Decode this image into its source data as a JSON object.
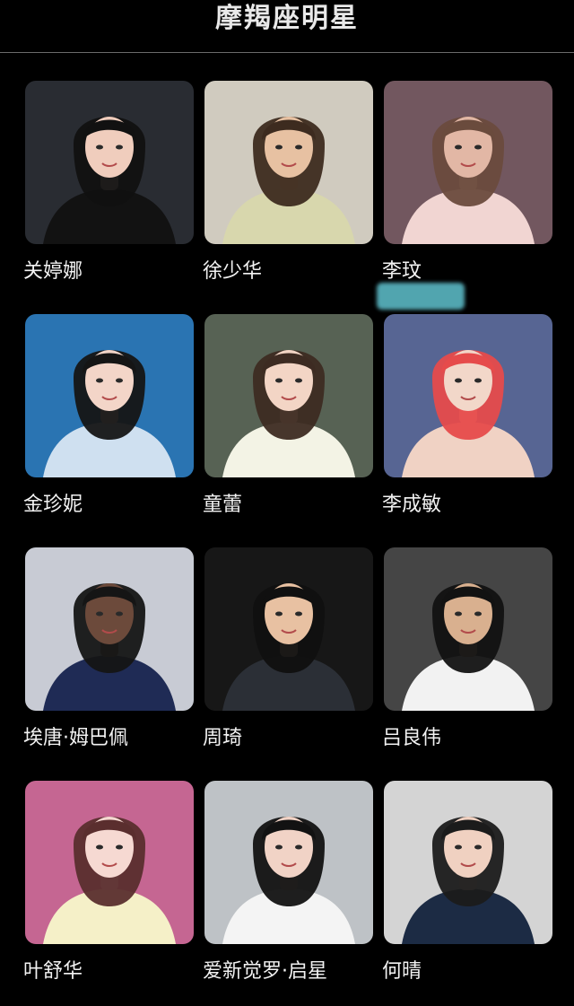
{
  "header": {
    "title": "摩羯座明星"
  },
  "celebrities": [
    {
      "name": "关婷娜",
      "bg": "#2d3037",
      "skin": "#f0cdbd",
      "hair": "#111111",
      "cloth": "#121212"
    },
    {
      "name": "徐少华",
      "bg": "#e2ddd0",
      "skin": "#e7c1a2",
      "hair": "#3d2b1f",
      "cloth": "#d8d7ad"
    },
    {
      "name": "李玟",
      "bg": "#7c5f68",
      "skin": "#e2b7a5",
      "hair": "#6a4b3d",
      "cloth": "#f1d5d2"
    },
    {
      "name": "金珍妮",
      "bg": "#2e7ec2",
      "skin": "#f3d5c8",
      "hair": "#151515",
      "cloth": "#cfe0f0"
    },
    {
      "name": "童蕾",
      "bg": "#5f6b5c",
      "skin": "#f3d5c5",
      "hair": "#3d2b22",
      "cloth": "#f3f3e5"
    },
    {
      "name": "李成敏",
      "bg": "#5f6ea0",
      "skin": "#f2d7c9",
      "hair": "#e64b4b",
      "cloth": "#f0d2c4"
    },
    {
      "name": "埃唐·姆巴佩",
      "bg": "#d9dde6",
      "skin": "#6c4a3b",
      "hair": "#151515",
      "cloth": "#1f2b55"
    },
    {
      "name": "周琦",
      "bg": "#1a1a1a",
      "skin": "#e8c1a2",
      "hair": "#101010",
      "cloth": "#2b2f36"
    },
    {
      "name": "吕良伟",
      "bg": "#4b4b4b",
      "skin": "#d9b08f",
      "hair": "#121212",
      "cloth": "#f2f2f2"
    },
    {
      "name": "叶舒华",
      "bg": "#d66f9f",
      "skin": "#f6d9d2",
      "hair": "#5a2e2e",
      "cloth": "#f5f0c8"
    },
    {
      "name": "爱新觉罗·启星",
      "bg": "#cfd3d7",
      "skin": "#f1d3c6",
      "hair": "#121212",
      "cloth": "#f4f4f4"
    },
    {
      "name": "何晴",
      "bg": "#e7e7e7",
      "skin": "#f0d1c1",
      "hair": "#1b1b1b",
      "cloth": "#1c2b44"
    }
  ]
}
